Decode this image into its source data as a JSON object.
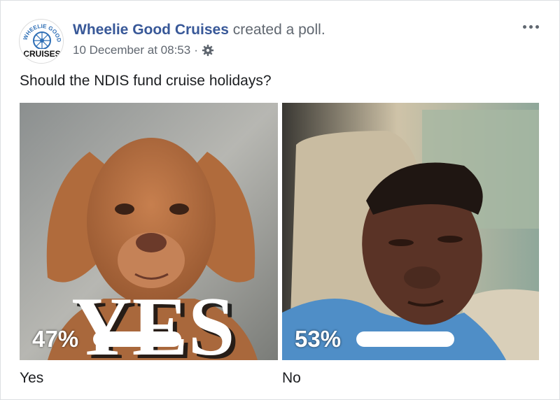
{
  "post": {
    "page_name": "Wheelie Good Cruises",
    "action": "created a poll.",
    "timestamp": "10 December at 08:53",
    "separator": "·",
    "privacy_icon": "gear-icon",
    "more_icon": "more-options-icon",
    "avatar": {
      "logo_text_top": "WHEELIE GOOD",
      "logo_text_bottom": "CRUISES"
    }
  },
  "poll": {
    "question": "Should the NDIS fund cruise holidays?",
    "options": [
      {
        "label": "Yes",
        "percent_text": "47%",
        "percent": 47,
        "image": "dog meme with text overlay",
        "overlay_text": "YES"
      },
      {
        "label": "No",
        "percent_text": "53%",
        "percent": 53,
        "image": "man sleeping in car seat"
      }
    ]
  },
  "colors": {
    "link": "#385898",
    "muted": "#606770",
    "text": "#1c1e21",
    "bar": "#ffffff"
  }
}
